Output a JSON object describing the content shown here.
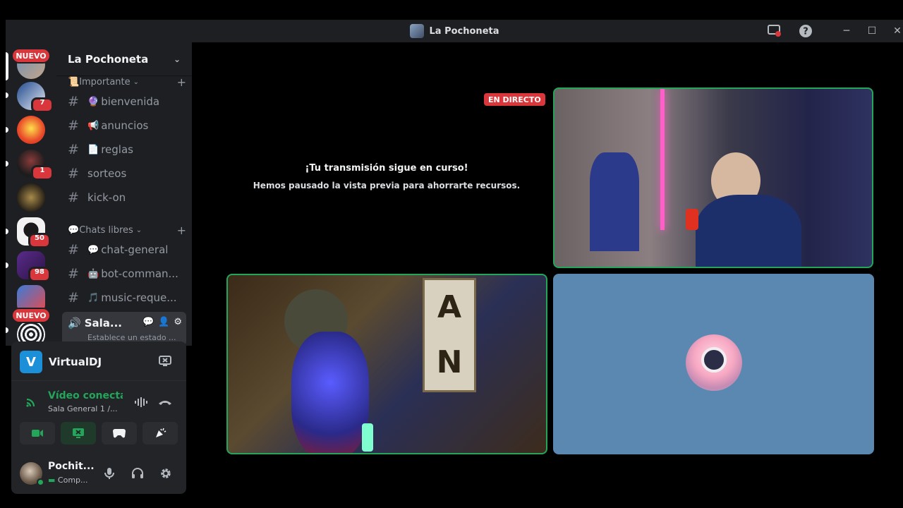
{
  "window": {
    "title": "La Pochoneta",
    "controls": {
      "screen_share": "screen-share-icon",
      "help": "help-icon",
      "minimize": "─",
      "maximize": "☐",
      "close": "✕"
    }
  },
  "rail": {
    "new_label": "NUEVO",
    "badges": [
      "7",
      "1",
      "50",
      "98"
    ]
  },
  "guild": {
    "name": "La Pochoneta",
    "categories": [
      {
        "icon": "📜",
        "label": "Importante",
        "channels": [
          {
            "emoji": "🔮",
            "name": "bienvenida"
          },
          {
            "emoji": "📢",
            "name": "anuncios"
          },
          {
            "emoji": "📄",
            "name": "reglas"
          },
          {
            "emoji": "",
            "name": "sorteos"
          },
          {
            "emoji": "",
            "name": "kick-on"
          }
        ]
      },
      {
        "icon": "💬",
        "label": "Chats libres",
        "channels": [
          {
            "emoji": "💬",
            "name": "chat-general"
          },
          {
            "emoji": "🤖",
            "name": "bot-comman..."
          },
          {
            "emoji": "🎵",
            "name": "music-reque..."
          }
        ]
      }
    ],
    "voice_channel": {
      "name": "Sala...",
      "status": "Establece un estado ..."
    }
  },
  "activity": {
    "app_name": "VirtualDJ",
    "app_initial": "V"
  },
  "voice": {
    "title": "Vídeo conectad",
    "subtitle": "Sala General 1 /..."
  },
  "user": {
    "name": "Pochit...",
    "status": "Comp..."
  },
  "stage": {
    "live_label": "EN DIRECTO",
    "paused_title": "¡Tu transmisión sigue en curso!",
    "paused_subtitle": "Hemos pausado la vista previa para ahorrarte recursos."
  },
  "colors": {
    "accent_green": "#23a55a",
    "badge_red": "#da373c",
    "tile_blue": "#5b88b1"
  }
}
